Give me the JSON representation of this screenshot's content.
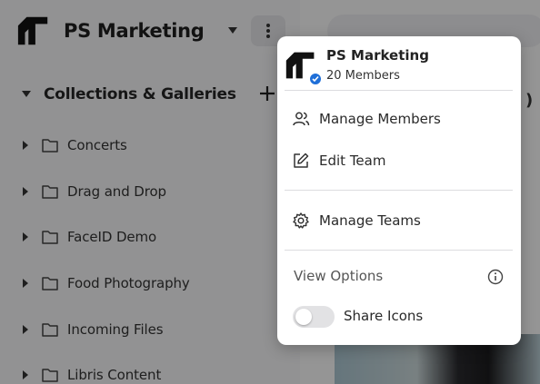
{
  "sidebar": {
    "team_name": "PS Marketing",
    "collections_title": "Collections & Galleries",
    "items": [
      {
        "label": "Concerts"
      },
      {
        "label": "Drag and Drop"
      },
      {
        "label": "FaceID Demo"
      },
      {
        "label": "Food Photography"
      },
      {
        "label": "Incoming Files"
      },
      {
        "label": "Libris Content"
      }
    ]
  },
  "main": {
    "partial_text": ")"
  },
  "menu": {
    "team_name": "PS Marketing",
    "member_count": "20 Members",
    "items": [
      {
        "label": "Manage Members",
        "icon": "users-icon"
      },
      {
        "label": "Edit Team",
        "icon": "edit-icon"
      },
      {
        "label": "Manage Teams",
        "icon": "gear-icon"
      }
    ],
    "view_options_label": "View Options",
    "share_icons_label": "Share Icons",
    "share_icons_enabled": false
  },
  "colors": {
    "accent": "#1f6fd8",
    "overlay": "rgba(0,0,0,0.40)"
  }
}
